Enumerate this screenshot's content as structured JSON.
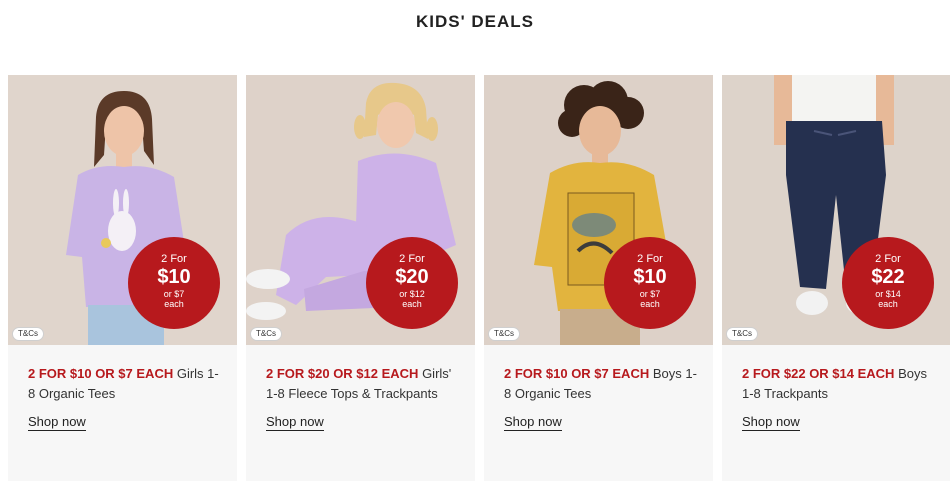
{
  "section": {
    "title": "KIDS' DEALS"
  },
  "colors": {
    "promo_red": "#b7191d",
    "card_bg": "#f7f7f7"
  },
  "cards": [
    {
      "tcs": "T&Cs",
      "badge": {
        "line1": "2 For",
        "price": "$10",
        "alt1": "or $7",
        "alt2": "each"
      },
      "promo": "2 FOR $10 OR $7 EACH",
      "desc": " Girls 1-8 Organic Tees",
      "cta": "Shop now"
    },
    {
      "tcs": "T&Cs",
      "badge": {
        "line1": "2 For",
        "price": "$20",
        "alt1": "or $12",
        "alt2": "each"
      },
      "promo": "2 FOR $20 OR $12 EACH",
      "desc": " Girls' 1-8 Fleece Tops & Trackpants",
      "cta": "Shop now"
    },
    {
      "tcs": "T&Cs",
      "badge": {
        "line1": "2 For",
        "price": "$10",
        "alt1": "or $7",
        "alt2": "each"
      },
      "promo": "2 FOR $10 OR $7 EACH",
      "desc": " Boys 1-8 Organic Tees",
      "cta": "Shop now"
    },
    {
      "tcs": "T&Cs",
      "badge": {
        "line1": "2 For",
        "price": "$22",
        "alt1": "or $14",
        "alt2": "each"
      },
      "promo": "2 FOR $22 OR $14 EACH",
      "desc": " Boys 1-8 Trackpants",
      "cta": "Shop now"
    }
  ]
}
